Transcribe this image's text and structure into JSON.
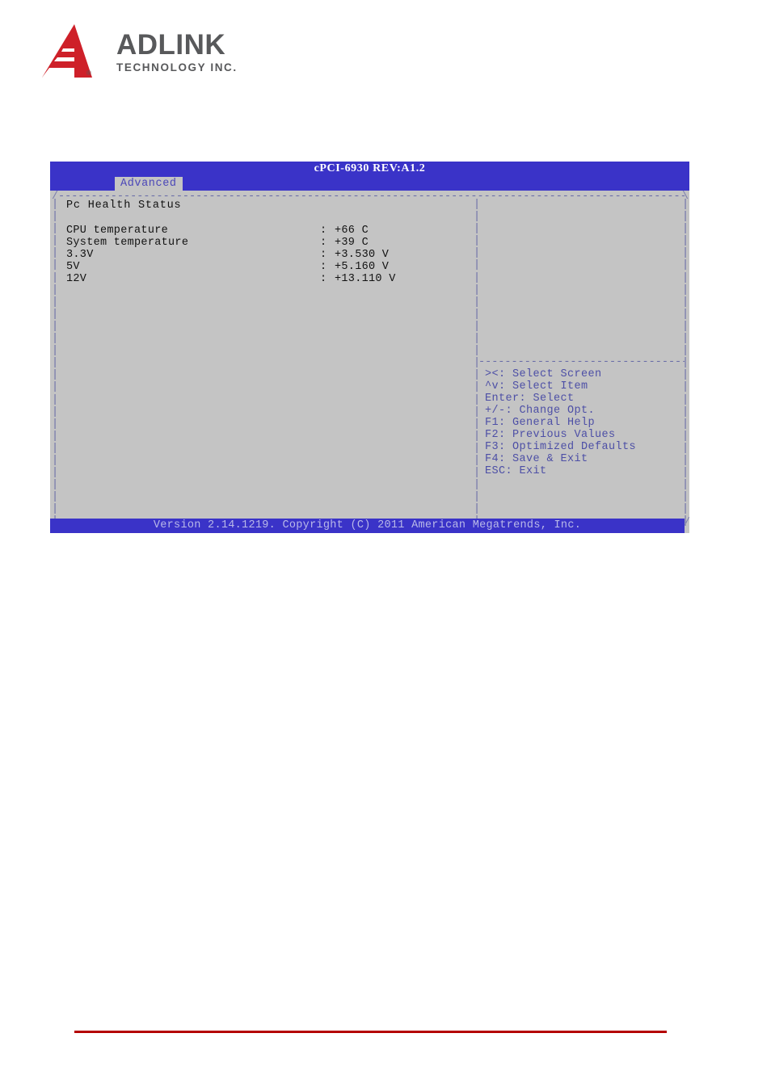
{
  "document": {
    "logo": {
      "mark": "adlink-triangle-logo",
      "wordmark": "ADLINK",
      "subtext": "TECHNOLOGY INC.",
      "registered_mark": "®",
      "brand_red": "#CE2029",
      "brand_gray": "#58595B"
    },
    "rule_color": "#B40000"
  },
  "bios": {
    "colors": {
      "bar_blue": "#3A33C8",
      "body_gray": "#C4C4C4",
      "frame_blue": "#6B6EA8",
      "help_text_blue": "#4D4FA6",
      "footer_text": "#B9B9E8"
    },
    "title": "cPCI-6930 REV:A1.2",
    "tabs": [
      {
        "label": "Advanced",
        "selected": true
      }
    ],
    "frame": {
      "top_left_corner": "/",
      "top_right_corner": "\\",
      "bottom_right_corner": "/",
      "horizontal": "-",
      "vertical": "|"
    },
    "left_panel": {
      "section_title": "Pc Health Status",
      "separator": ":",
      "rows": [
        {
          "label": "CPU temperature",
          "value": "+66 C"
        },
        {
          "label": "System temperature",
          "value": "+39 C"
        },
        {
          "label": "3.3V",
          "value": "+3.530 V"
        },
        {
          "label": "5V",
          "value": "+5.160 V"
        },
        {
          "label": "12V",
          "value": "+13.110 V"
        }
      ]
    },
    "right_panel": {
      "help_items": [
        "><: Select Screen",
        "^v: Select Item",
        "Enter: Select",
        "+/-: Change Opt.",
        "F1: General Help",
        "F2: Previous Values",
        "F3: Optimized Defaults",
        "F4: Save & Exit",
        "ESC: Exit"
      ]
    },
    "footer": "Version 2.14.1219. Copyright (C) 2011 American Megatrends, Inc."
  }
}
